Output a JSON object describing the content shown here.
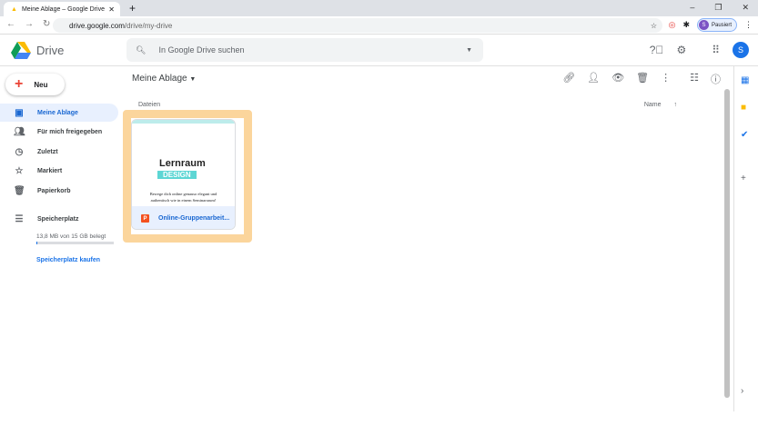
{
  "browser": {
    "tab_title": "Meine Ablage – Google Drive",
    "url_host": "drive.google.com",
    "url_path": "/drive/my-drive",
    "profile_label": "Pausiert",
    "profile_initial": "S"
  },
  "header": {
    "app_name": "Drive",
    "search_placeholder": "In Google Drive suchen",
    "user_initial": "S"
  },
  "sidebar": {
    "new_label": "Neu",
    "items": [
      {
        "label": "Meine Ablage",
        "icon": "drive-icon",
        "active": true
      },
      {
        "label": "Für mich freigegeben",
        "icon": "people-icon"
      },
      {
        "label": "Zuletzt",
        "icon": "clock-icon"
      },
      {
        "label": "Markiert",
        "icon": "star-icon"
      },
      {
        "label": "Papierkorb",
        "icon": "trash-icon"
      }
    ],
    "storage_label": "Speicherplatz",
    "storage_usage": "13,8 MB von 15 GB belegt",
    "storage_percent": 0.1,
    "buy_storage": "Speicherplatz kaufen"
  },
  "main": {
    "title": "Meine Ablage",
    "section": "Dateien",
    "sort_label": "Name",
    "files": [
      {
        "name": "Online-Gruppenarbeit...",
        "type": "powerpoint",
        "thumb_title": "Lernraum",
        "thumb_brand": "DESIGN",
        "thumb_text": "Bewege dich online genauso elegant und authentisch wie in einem Seminarraum!"
      }
    ]
  },
  "colors": {
    "accent": "#1a73e8",
    "highlight": "#fbd59c",
    "active_bg": "#e8f0fe"
  }
}
